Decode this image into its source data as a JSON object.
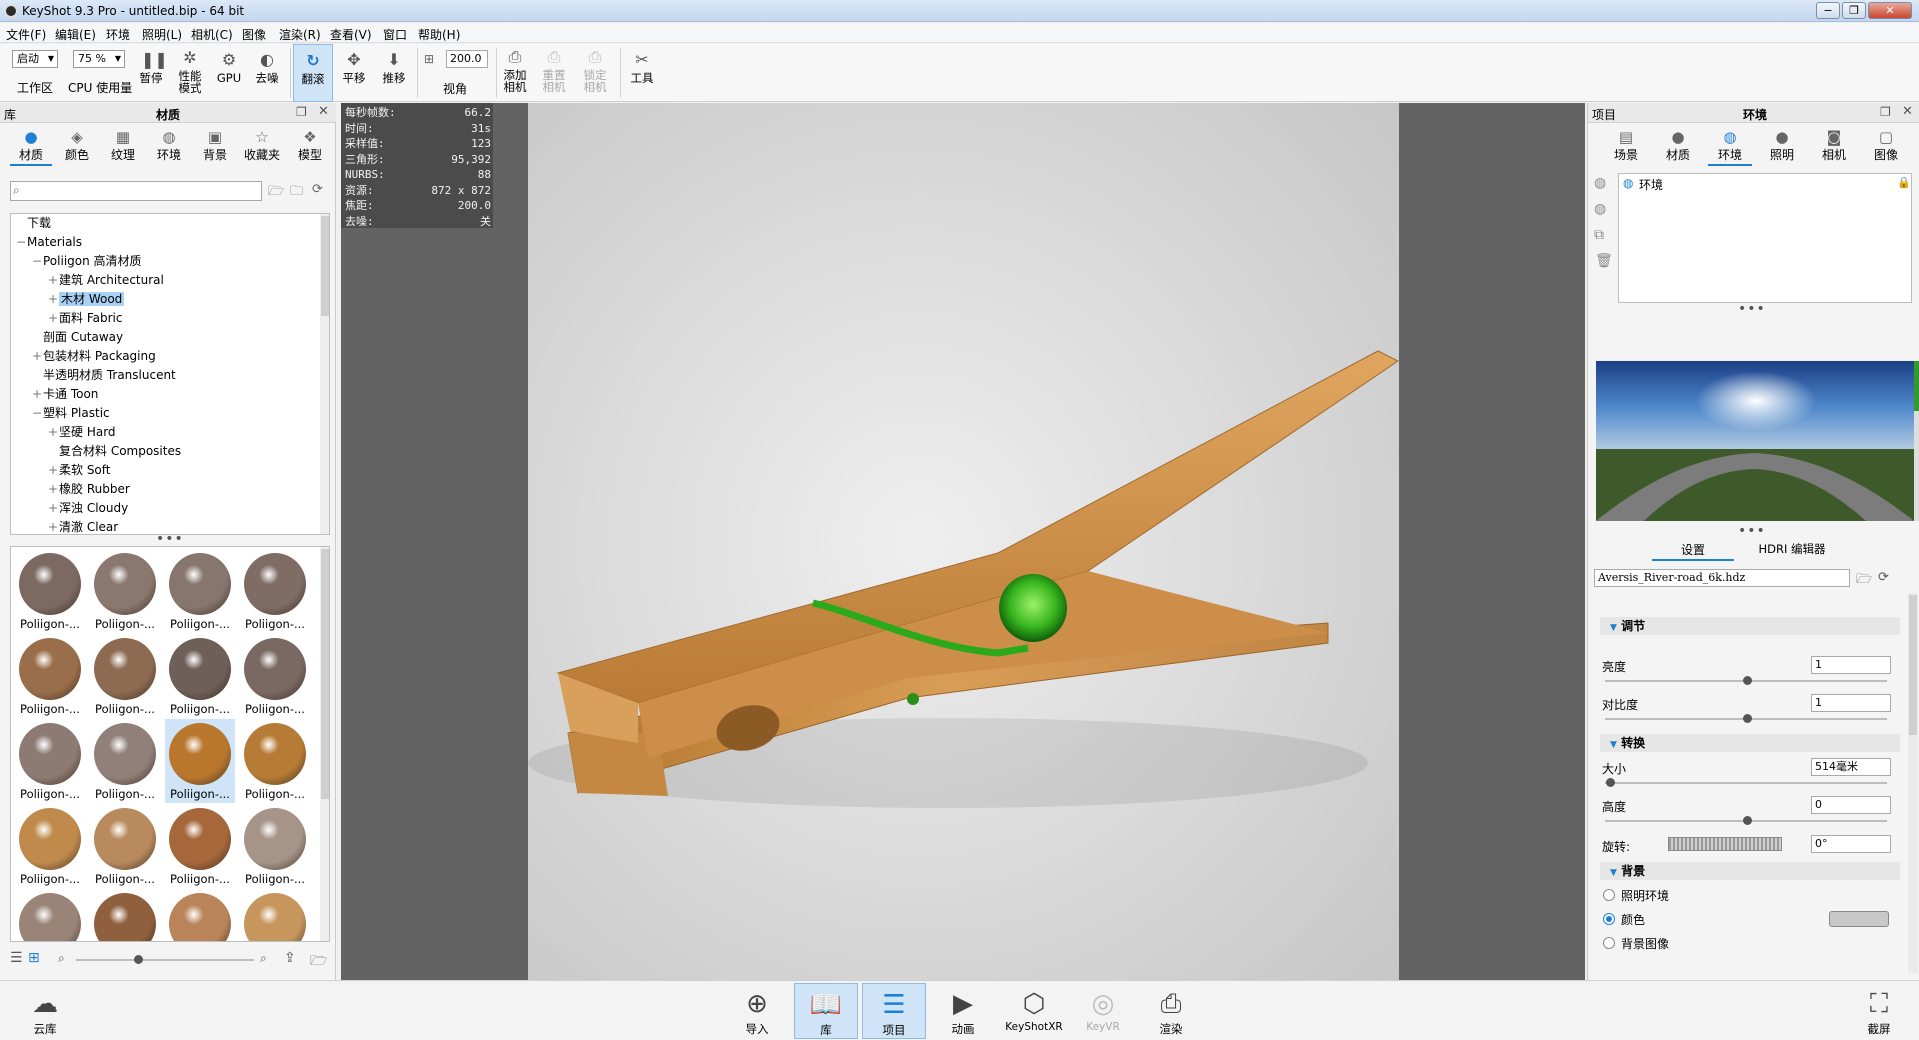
{
  "window": {
    "title": "KeyShot 9.3 Pro  - untitled.bip  - 64 bit"
  },
  "menu": [
    "文件(F)",
    "编辑(E)",
    "环境",
    "照明(L)",
    "相机(C)",
    "图像",
    "渲染(R)",
    "查看(V)",
    "窗口",
    "帮助(H)"
  ],
  "toolbar": {
    "workspace_select": "启动",
    "cpu_select": "75 %",
    "workspace_label": "工作区",
    "cpu_label": "CPU 使用量",
    "pause": "暂停",
    "perf_mode": "性能\n模式",
    "gpu": "GPU",
    "denoise": "去噪",
    "tumble": "翻滚",
    "pan": "平移",
    "dolly": "推移",
    "fov_value": "200.0",
    "fov_label": "视角",
    "add_camera": "添加\n相机",
    "reset_camera": "重置\n相机",
    "lock_camera": "锁定\n相机",
    "tools": "工具"
  },
  "library": {
    "panel_label": "库",
    "panel_title": "材质",
    "tabs": [
      "材质",
      "颜色",
      "纹理",
      "环境",
      "背景",
      "收藏夹",
      "模型"
    ],
    "search_placeholder": "",
    "tree": [
      {
        "label": "下载",
        "indent": 0,
        "pm": ""
      },
      {
        "label": "Materials",
        "indent": 0,
        "pm": "−"
      },
      {
        "label": "Poliigon 高清材质",
        "indent": 1,
        "pm": "−"
      },
      {
        "label": "建筑 Architectural",
        "indent": 2,
        "pm": "+"
      },
      {
        "label": "木材 Wood",
        "indent": 2,
        "pm": "+",
        "selected": true
      },
      {
        "label": "面料 Fabric",
        "indent": 2,
        "pm": "+"
      },
      {
        "label": "剖面 Cutaway",
        "indent": 1,
        "pm": ""
      },
      {
        "label": "包装材料 Packaging",
        "indent": 1,
        "pm": "+"
      },
      {
        "label": "半透明材质 Translucent",
        "indent": 1,
        "pm": ""
      },
      {
        "label": "卡通 Toon",
        "indent": 1,
        "pm": "+"
      },
      {
        "label": "塑料 Plastic",
        "indent": 1,
        "pm": "−"
      },
      {
        "label": "坚硬 Hard",
        "indent": 2,
        "pm": "+"
      },
      {
        "label": "复合材料 Composites",
        "indent": 2,
        "pm": ""
      },
      {
        "label": "柔软 Soft",
        "indent": 2,
        "pm": "+"
      },
      {
        "label": "橡胶 Rubber",
        "indent": 2,
        "pm": "+"
      },
      {
        "label": "浑浊 Cloudy",
        "indent": 2,
        "pm": "+"
      },
      {
        "label": "清澈 Clear",
        "indent": 2,
        "pm": "+"
      }
    ],
    "thumbs": [
      {
        "label": "Poliigon-...",
        "color": "#7c6a62"
      },
      {
        "label": "Poliigon-...",
        "color": "#8a786e"
      },
      {
        "label": "Poliigon-...",
        "color": "#86766d"
      },
      {
        "label": "Poliigon-...",
        "color": "#7f6d65"
      },
      {
        "label": "Poliigon-...",
        "color": "#9a6e4a"
      },
      {
        "label": "Poliigon-...",
        "color": "#8c6b52"
      },
      {
        "label": "Poliigon-...",
        "color": "#6e5f58"
      },
      {
        "label": "Poliigon-...",
        "color": "#7a6963"
      },
      {
        "label": "Poliigon-...",
        "color": "#8d7a72"
      },
      {
        "label": "Poliigon-...",
        "color": "#918079"
      },
      {
        "label": "Poliigon-...",
        "color": "#b9772e",
        "selected": true
      },
      {
        "label": "Poliigon-...",
        "color": "#b67b35"
      },
      {
        "label": "Poliigon-...",
        "color": "#c08a4c"
      },
      {
        "label": "Poliigon-...",
        "color": "#b98a5d"
      },
      {
        "label": "Poliigon-...",
        "color": "#a6673a"
      },
      {
        "label": "Poliigon-...",
        "color": "#a69488"
      },
      {
        "label": "",
        "color": "#9a8478"
      },
      {
        "label": "",
        "color": "#8f5f3e"
      },
      {
        "label": "",
        "color": "#b9845a"
      },
      {
        "label": "",
        "color": "#c6965d"
      }
    ]
  },
  "stats": [
    {
      "k": "每秒帧数:",
      "v": "66.2"
    },
    {
      "k": "时间:",
      "v": "31s"
    },
    {
      "k": "采样值:",
      "v": "123"
    },
    {
      "k": "三角形:",
      "v": "95,392"
    },
    {
      "k": "NURBS:",
      "v": "88"
    },
    {
      "k": "资源:",
      "v": "872 x 872"
    },
    {
      "k": "焦距:",
      "v": "200.0"
    },
    {
      "k": "去噪:",
      "v": "关"
    }
  ],
  "project": {
    "panel_label": "项目",
    "panel_title": "环境",
    "tabs": [
      "场景",
      "材质",
      "环境",
      "照明",
      "相机",
      "图像"
    ],
    "env_item": "环境",
    "subtabs": [
      "设置",
      "HDRI 编辑器"
    ],
    "hdri_file": "Aversis_River-road_6k.hdz",
    "sections": {
      "adjust": "调节",
      "brightness_label": "亮度",
      "brightness_value": "1",
      "contrast_label": "对比度",
      "contrast_value": "1",
      "transform": "转换",
      "size_label": "大小",
      "size_value": "514毫米",
      "height_label": "高度",
      "height_value": "0",
      "rotate_label": "旋转:",
      "rotate_value": "0°",
      "background": "背景",
      "bg_opt1": "照明环境",
      "bg_opt2": "颜色",
      "bg_opt3": "背景图像"
    },
    "bg_color": "#c8c8c8"
  },
  "bottombar": {
    "cloud": "云库",
    "import": "导入",
    "library": "库",
    "project": "项目",
    "animation": "动画",
    "keyshotxr": "KeyShotXR",
    "keyvr": "KeyVR",
    "render": "渲染",
    "screenshot": "截屏"
  }
}
